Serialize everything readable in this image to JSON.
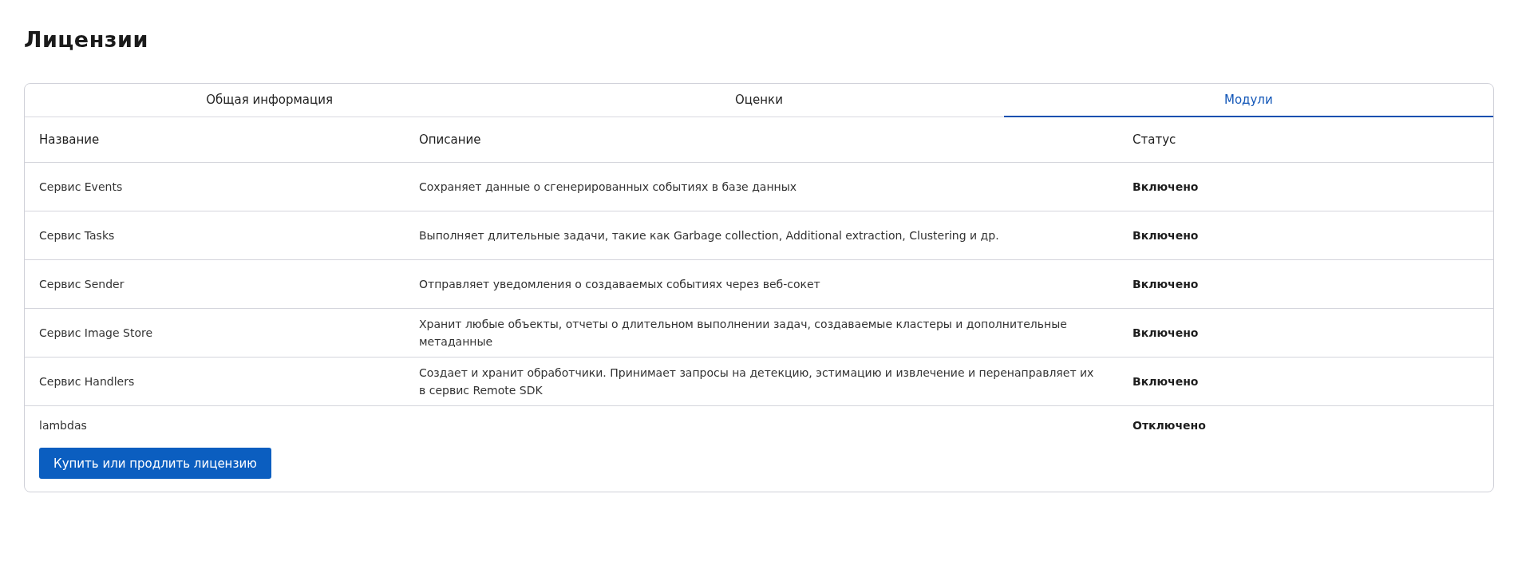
{
  "title": "Лицензии",
  "tabs": [
    {
      "label": "Общая информация",
      "selected": false
    },
    {
      "label": "Оценки",
      "selected": false
    },
    {
      "label": "Модули",
      "selected": true
    }
  ],
  "table": {
    "columns": [
      "Название",
      "Описание",
      "Статус"
    ],
    "rows": [
      {
        "name": "Сервис Events",
        "description": "Сохраняет данные о сгенерированных событиях в базе данных",
        "status": "Включено"
      },
      {
        "name": "Сервис Tasks",
        "description": "Выполняет длительные задачи, такие как Garbage collection, Additional extraction, Clustering и др.",
        "status": "Включено"
      },
      {
        "name": "Сервис Sender",
        "description": "Отправляет уведомления о создаваемых событиях через веб-сокет",
        "status": "Включено"
      },
      {
        "name": "Сервис Image Store",
        "description": "Хранит любые объекты, отчеты о длительном выполнении задач, создаваемые кластеры и дополнительные метаданные",
        "status": "Включено"
      },
      {
        "name": "Сервис Handlers",
        "description": "Создает и хранит обработчики. Принимает запросы на детекцию, эстимацию и извлечение и перенаправляет их в сервис Remote SDK",
        "status": "Включено"
      },
      {
        "name": "lambdas",
        "description": "",
        "status": "Отключено"
      }
    ]
  },
  "button": "Купить или продлить лицензию"
}
